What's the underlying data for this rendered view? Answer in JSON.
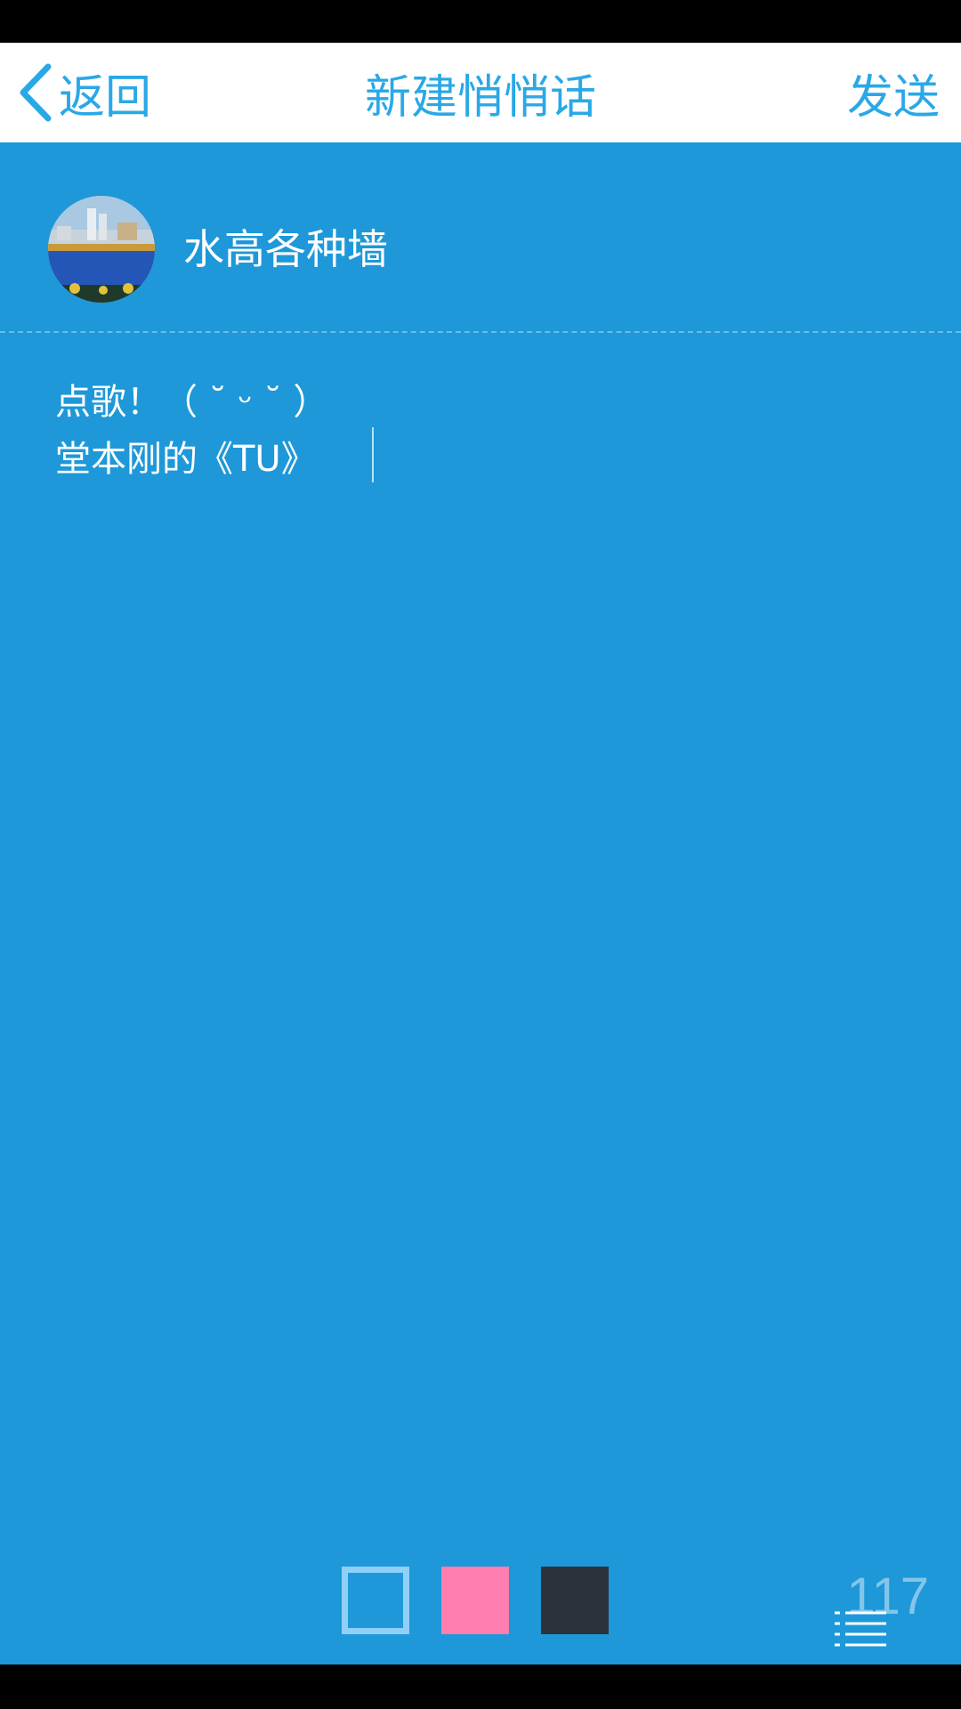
{
  "nav": {
    "back_label": "返回",
    "title": "新建悄悄话",
    "send_label": "发送",
    "back_icon": "chevron-left-icon",
    "accent_color": "#2aa8e6"
  },
  "profile": {
    "username": "水高各种墙"
  },
  "message": {
    "line1": "点歌！（ ˘ ᵕ ˘ ）",
    "line2": "堂本刚的《TU》"
  },
  "background_colors": {
    "options": [
      "#1e98d8",
      "#ff7eb0",
      "#2b323a"
    ],
    "selected": "#1e98d8"
  },
  "char_count": "117",
  "list_icon": "list-icon"
}
